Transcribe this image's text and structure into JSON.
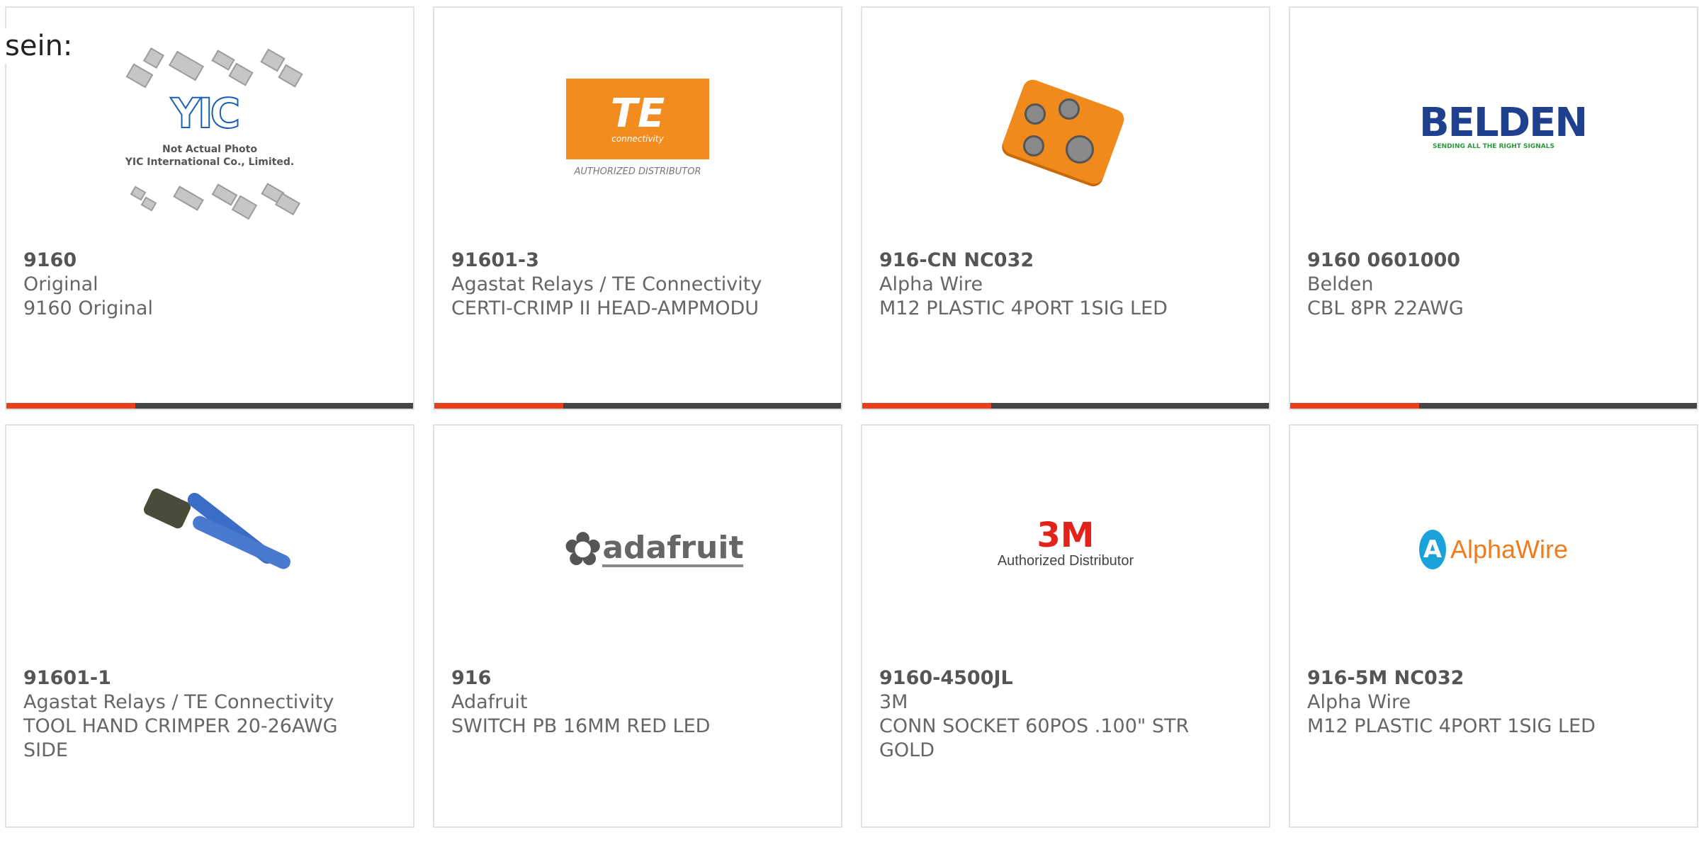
{
  "heading": "sein:",
  "cards": [
    {
      "part": "9160",
      "maker": "Original",
      "desc": "9160 Original"
    },
    {
      "part": "91601-3",
      "maker": "Agastat Relays / TE Connectivity",
      "desc": "CERTI-CRIMP II HEAD-AMPMODU"
    },
    {
      "part": "916-CN NC032",
      "maker": "Alpha Wire",
      "desc": "M12 PLASTIC 4PORT 1SIG LED"
    },
    {
      "part": "9160 0601000",
      "maker": "Belden",
      "desc": "CBL 8PR 22AWG"
    },
    {
      "part": "91601-1",
      "maker": "Agastat Relays / TE Connectivity",
      "desc": "TOOL HAND CRIMPER 20-26AWG SIDE"
    },
    {
      "part": "916",
      "maker": "Adafruit",
      "desc": "SWITCH PB 16MM RED LED"
    },
    {
      "part": "9160-4500JL",
      "maker": "3M",
      "desc": "CONN SOCKET 60POS .100\" STR GOLD"
    },
    {
      "part": "916-5M NC032",
      "maker": "Alpha Wire",
      "desc": "M12 PLASTIC 4PORT 1SIG LED"
    }
  ],
  "logos": {
    "yic_mark": "YIC",
    "yic_caption1": "Not Actual Photo",
    "yic_caption2": "YIC International Co., Limited.",
    "te_mark": "TE",
    "te_sub": "connectivity",
    "te_dist": "AUTHORIZED DISTRIBUTOR",
    "belden_mark": "BELDEN",
    "belden_tag": "SENDING ALL THE RIGHT SIGNALS",
    "adafruit_mark": "adafruit",
    "mmm_mark": "3M",
    "mmm_dist": "Authorized Distributor",
    "alpha_letter": "A",
    "alpha_mark": "AlphaWire"
  },
  "accent_color": "#e8401c",
  "bar_color": "#444444"
}
